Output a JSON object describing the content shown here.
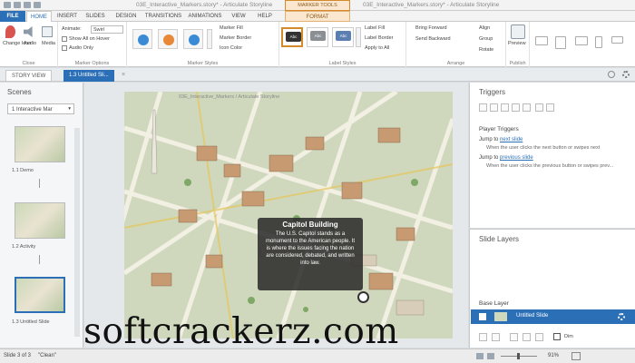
{
  "window": {
    "title": "03E_Interactive_Markers.story* - Articulate Storyline",
    "title2": "03E_Interactive_Markers.story* - Articulate Storyline",
    "context_tab": "MARKER TOOLS"
  },
  "tabs": [
    "FILE",
    "HOME",
    "INSERT",
    "SLIDES",
    "DESIGN",
    "TRANSITIONS",
    "ANIMATIONS",
    "VIEW",
    "HELP",
    "FORMAT"
  ],
  "ribbon": {
    "close": {
      "labels": [
        "Change Icon",
        "Audio",
        "Media"
      ],
      "group": "Close"
    },
    "marker_options": {
      "animate_label": "Animate:",
      "animate_value": "Swirl",
      "show_all": "Show All on Hover",
      "audio_only": "Audio Only",
      "group": "Marker Options"
    },
    "marker_styles": {
      "fill": "Marker Fill",
      "border": "Marker Border",
      "icon_color": "Icon Color",
      "group": "Marker Styles"
    },
    "label_styles": {
      "sample": "Abc",
      "fill": "Label Fill",
      "border": "Label Border",
      "apply": "Apply to All",
      "group": "Label Styles"
    },
    "arrange": {
      "bring_forward": "Bring Forward",
      "send_backward": "Send Backward",
      "align": "Align",
      "group_btn": "Group",
      "rotate": "Rotate",
      "group": "Arrange"
    },
    "publish": {
      "preview": "Preview",
      "group": "Publish"
    }
  },
  "view_tabs": {
    "story_view": "STORY VIEW",
    "current": "1.3 Untitled Sli..."
  },
  "scenes": {
    "title": "Scenes",
    "selector": "1 Interactive Mar",
    "slides": [
      {
        "caption": "1.1 Demo"
      },
      {
        "caption": "1.2 Activity"
      },
      {
        "caption": "1.3 Untitled Slide"
      }
    ]
  },
  "slide": {
    "header": "03E_Interactive_Markers / Articulate Storyline",
    "callout_title": "Capitol Building",
    "callout_body": "The U.S. Capitol stands as a monument to the American people. It is where the issues facing the nation are considered, debated, and written into law."
  },
  "watermark": "softcrackerz.com",
  "triggers": {
    "title": "Triggers",
    "section": "Player Triggers",
    "t1_prefix": "Jump to ",
    "t1_link": "next slide",
    "t1_desc": "When the user clicks the next button or swipes next",
    "t2_prefix": "Jump to ",
    "t2_link": "previous slide",
    "t2_desc": "When the user clicks the previous button or swipes prev..."
  },
  "layers": {
    "title": "Slide Layers",
    "base": "Base Layer",
    "row": "Untitled Slide",
    "dim": "Dim"
  },
  "status": {
    "slide": "Slide 3 of 3",
    "theme": "\"Clean\"",
    "zoom": "91%"
  },
  "colors": {
    "accent": "#2b6fb6",
    "context": "#fbe7cf",
    "marker_blue": "#3a8ad6",
    "marker_orange": "#e8893a"
  }
}
